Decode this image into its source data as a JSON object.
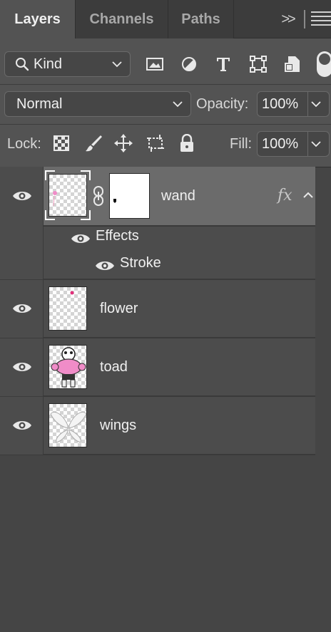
{
  "tabs": [
    {
      "label": "Layers",
      "active": true
    },
    {
      "label": "Channels",
      "active": false
    },
    {
      "label": "Paths",
      "active": false
    }
  ],
  "tabbar": {
    "overflow_glyph": ">>",
    "menu_icon": "panel-menu-icon"
  },
  "filter": {
    "kind_label": "Kind",
    "icons": [
      "image-filter-icon",
      "adjustment-filter-icon",
      "type-filter-icon",
      "shape-filter-icon",
      "smart-object-filter-icon"
    ]
  },
  "blend": {
    "mode": "Normal",
    "opacity_label": "Opacity:",
    "opacity_value": "100%"
  },
  "lock": {
    "label": "Lock:",
    "icons": [
      "lock-transparent-pixels-icon",
      "lock-image-pixels-icon",
      "lock-position-icon",
      "lock-artboard-icon",
      "lock-all-icon"
    ],
    "fill_label": "Fill:",
    "fill_value": "100%"
  },
  "layers": [
    {
      "name": "wand",
      "visible": true,
      "selected": true,
      "has_mask": true,
      "fx": "fx",
      "effects_label": "Effects",
      "effects": [
        {
          "name": "Stroke",
          "visible": true
        }
      ]
    },
    {
      "name": "flower",
      "visible": true,
      "selected": false
    },
    {
      "name": "toad",
      "visible": true,
      "selected": false
    },
    {
      "name": "wings",
      "visible": true,
      "selected": false
    }
  ],
  "colors": {
    "panel": "#535353",
    "tabbar": "#3c3c3c",
    "selected_row": "#6b6b6b",
    "row": "#4c4c4c",
    "text": "#f0f0f0",
    "pink": "#f08cc8"
  }
}
